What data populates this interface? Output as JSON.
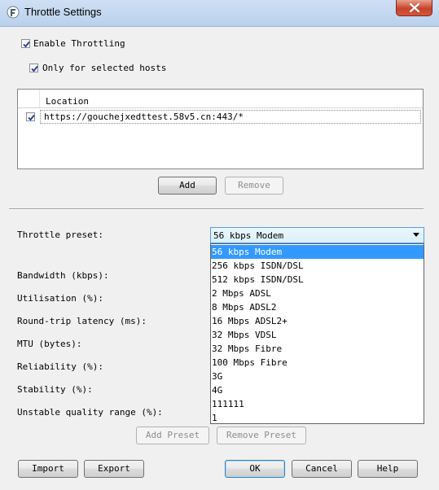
{
  "window": {
    "title": "Throttle Settings"
  },
  "options": {
    "enable_throttling": {
      "label": "Enable Throttling",
      "checked": true
    },
    "only_selected_hosts": {
      "label": "Only for selected hosts",
      "checked": true
    }
  },
  "hosts_table": {
    "column_header": "Location",
    "rows": [
      {
        "checked": true,
        "location": "https://gouchejxedttest.58v5.cn:443/*"
      }
    ]
  },
  "host_buttons": {
    "add": "Add",
    "remove": "Remove"
  },
  "settings": {
    "throttle_preset_label": "Throttle preset:",
    "bandwidth_label": "Bandwidth (kbps):",
    "utilisation_label": "Utilisation (%):",
    "latency_label": "Round-trip latency (ms):",
    "mtu_label": "MTU (bytes):",
    "reliability_label": "Reliability (%):",
    "stability_label": "Stability (%):",
    "unstable_range_label": "Unstable quality range (%):"
  },
  "preset_combo": {
    "selected": "56 kbps Modem",
    "options": [
      "56 kbps Modem",
      "256 kbps ISDN/DSL",
      "512 kbps ISDN/DSL",
      "2 Mbps ADSL",
      "8 Mbps ADSL2",
      "16 Mbps ADSL2+",
      "32 Mbps VDSL",
      "32 Mbps Fibre",
      "100 Mbps Fibre",
      "3G",
      "4G",
      "111111",
      "1"
    ]
  },
  "preset_buttons": {
    "add_preset": "Add Preset",
    "remove_preset": "Remove Preset"
  },
  "footer_buttons": {
    "import": "Import",
    "export": "Export",
    "ok": "OK",
    "cancel": "Cancel",
    "help": "Help"
  },
  "colors": {
    "selection": "#3399ff",
    "close_button": "#c7432b",
    "title_bar": "#b9d0ec"
  }
}
